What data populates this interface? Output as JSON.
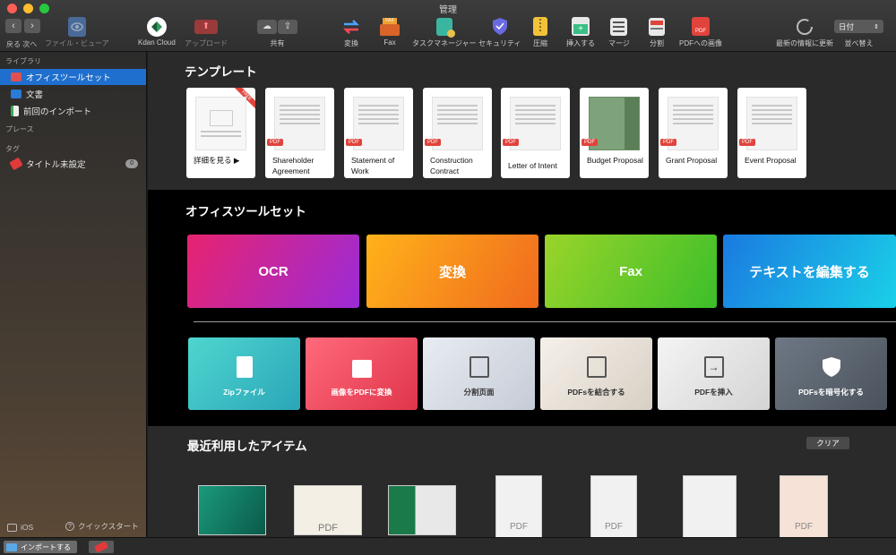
{
  "window": {
    "title": "管理"
  },
  "toolbar": {
    "nav_label": "戻る 次へ",
    "items": [
      {
        "label": "ファイル・ビューア"
      },
      {
        "label": "Kdan Cloud"
      },
      {
        "label": "アップロード"
      },
      {
        "label": "共有"
      },
      {
        "label": "変換"
      },
      {
        "label": "Fax"
      },
      {
        "label": "タスクマネージャー"
      },
      {
        "label": "セキュリティ"
      },
      {
        "label": "圧縮"
      },
      {
        "label": "挿入する"
      },
      {
        "label": "マージ"
      },
      {
        "label": "分割"
      },
      {
        "label": "PDFへの画像"
      },
      {
        "label": "最新の情報に更新"
      },
      {
        "label": "並べ替え"
      }
    ],
    "fax_badge": "FAX",
    "pdf_badge": "PDF",
    "sort_value": "日付"
  },
  "sidebar": {
    "library_header": "ライブラリ",
    "items": [
      {
        "label": "オフィスツールセット"
      },
      {
        "label": "文書"
      },
      {
        "label": "前回のインポート"
      }
    ],
    "places_header": "プレース",
    "tags_header": "タグ",
    "tag_item": {
      "label": "タイトル未設定",
      "count": "0"
    },
    "footer_ios": "iOS",
    "footer_quickstart": "クイックスタート"
  },
  "bottombar": {
    "import_label": "インポートする"
  },
  "templates": {
    "heading": "テンプレート",
    "free_badge": "FREE",
    "pdf_tag": "PDF",
    "cards": [
      {
        "label": "詳細を見る ▶"
      },
      {
        "label": "Shareholder Agreement"
      },
      {
        "label": "Statement of Work"
      },
      {
        "label": "Construction Contract"
      },
      {
        "label": "Letter of Intent"
      },
      {
        "label": "Budget Proposal"
      },
      {
        "label": "Grant Proposal"
      },
      {
        "label": "Event Proposal"
      }
    ]
  },
  "office": {
    "heading": "オフィスツールセット",
    "heroes": [
      {
        "label": "OCR"
      },
      {
        "label": "変換"
      },
      {
        "label": "Fax"
      },
      {
        "label": "テキストを編集する"
      }
    ],
    "tools": [
      {
        "label": "Zipファイル"
      },
      {
        "label": "画像をPDFに変換"
      },
      {
        "label": "分割页面"
      },
      {
        "label": "PDFsを結合する"
      },
      {
        "label": "PDFを挿入"
      },
      {
        "label": "PDFsを暗号化する"
      }
    ]
  },
  "recent": {
    "heading": "最近利用したアイテム",
    "clear_label": "クリア",
    "pdf_text": "PDF"
  },
  "colors": {
    "accent": "#1f6fce",
    "pdf_red": "#e0433b"
  }
}
